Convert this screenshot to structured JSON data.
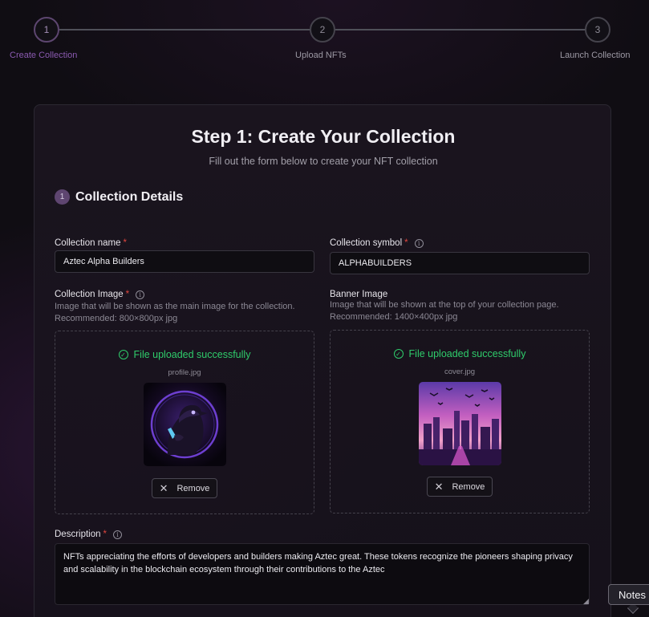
{
  "stepper": {
    "steps": [
      {
        "number": "1",
        "label": "Create Collection"
      },
      {
        "number": "2",
        "label": "Upload NFTs"
      },
      {
        "number": "3",
        "label": "Launch Collection"
      }
    ],
    "active_step": 1
  },
  "form": {
    "title": "Step 1: Create Your Collection",
    "subtitle": "Fill out the form below to create your NFT collection",
    "section": {
      "number": "1",
      "title": "Collection Details"
    },
    "name": {
      "label": "Collection name",
      "required": "*",
      "value": "Aztec Alpha Builders"
    },
    "symbol": {
      "label": "Collection symbol",
      "required": "*",
      "value": "ALPHABUILDERS"
    },
    "collection_image": {
      "label": "Collection Image",
      "required": "*",
      "help": "Image that will be shown as the main image for the collection. Recommended: 800×800px jpg",
      "status": "File uploaded successfully",
      "file_name": "profile.jpg",
      "remove_label": "Remove"
    },
    "banner_image": {
      "label": "Banner Image",
      "help": "Image that will be shown at the top of your collection page. Recommended: 1400×400px jpg",
      "status": "File uploaded successfully",
      "file_name": "cover.jpg",
      "remove_label": "Remove"
    },
    "description": {
      "label": "Description",
      "required": "*",
      "value": "NFTs appreciating the efforts of developers and builders making Aztec great. These tokens recognize the pioneers shaping privacy and scalability in the blockchain ecosystem through their contributions to the Aztec"
    }
  },
  "tooltip": {
    "label": "Notes"
  },
  "colors": {
    "accent": "#8a5ab0",
    "success": "#2fcc6b",
    "required": "#e0463f",
    "background": "#100d13"
  },
  "icons": [
    "info-icon",
    "check-circle-icon",
    "close-icon"
  ]
}
